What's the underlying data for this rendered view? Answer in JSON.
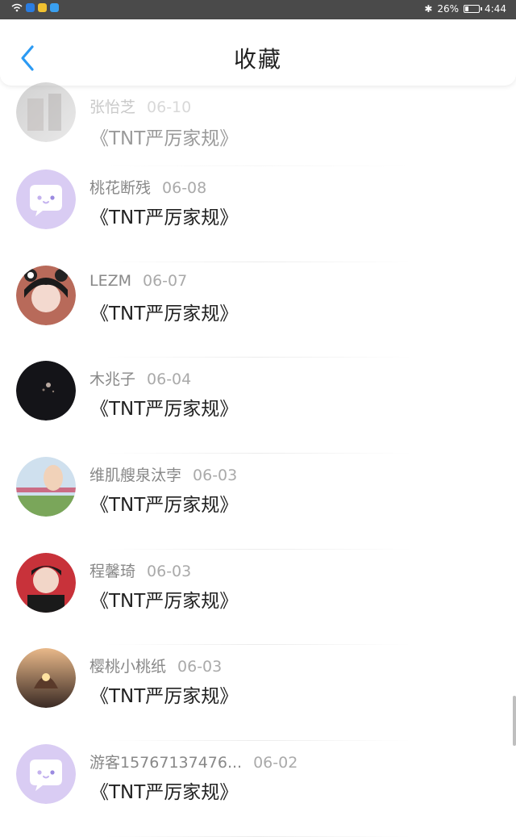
{
  "status": {
    "battery": "26%",
    "battery_level": 0.26,
    "time": "4:44"
  },
  "header": {
    "title": "收藏"
  },
  "items": [
    {
      "user": "张怡芝",
      "date": "06-10",
      "work": "《TNT严厉家规》",
      "avatar": "photo-gray"
    },
    {
      "user": "桃花断残",
      "date": "06-08",
      "work": "《TNT严厉家规》",
      "avatar": "chat-bubble"
    },
    {
      "user": "LEZM",
      "date": "06-07",
      "work": "《TNT严厉家规》",
      "avatar": "photo-girl"
    },
    {
      "user": "木兆子",
      "date": "06-04",
      "work": "《TNT严厉家规》",
      "avatar": "photo-dark"
    },
    {
      "user": "维肌艘泉汰孛",
      "date": "06-03",
      "work": "《TNT严厉家规》",
      "avatar": "photo-field"
    },
    {
      "user": "程馨琦",
      "date": "06-03",
      "work": "《TNT严厉家规》",
      "avatar": "photo-red"
    },
    {
      "user": "樱桃小桃纸",
      "date": "06-03",
      "work": "《TNT严厉家规》",
      "avatar": "photo-sunset"
    },
    {
      "user": "游客15767137476...",
      "date": "06-02",
      "work": "《TNT严厉家规》",
      "avatar": "chat-bubble"
    }
  ],
  "colors": {
    "accent": "#2b9af3",
    "avatar_bubble_bg": "#d9ccf3"
  }
}
